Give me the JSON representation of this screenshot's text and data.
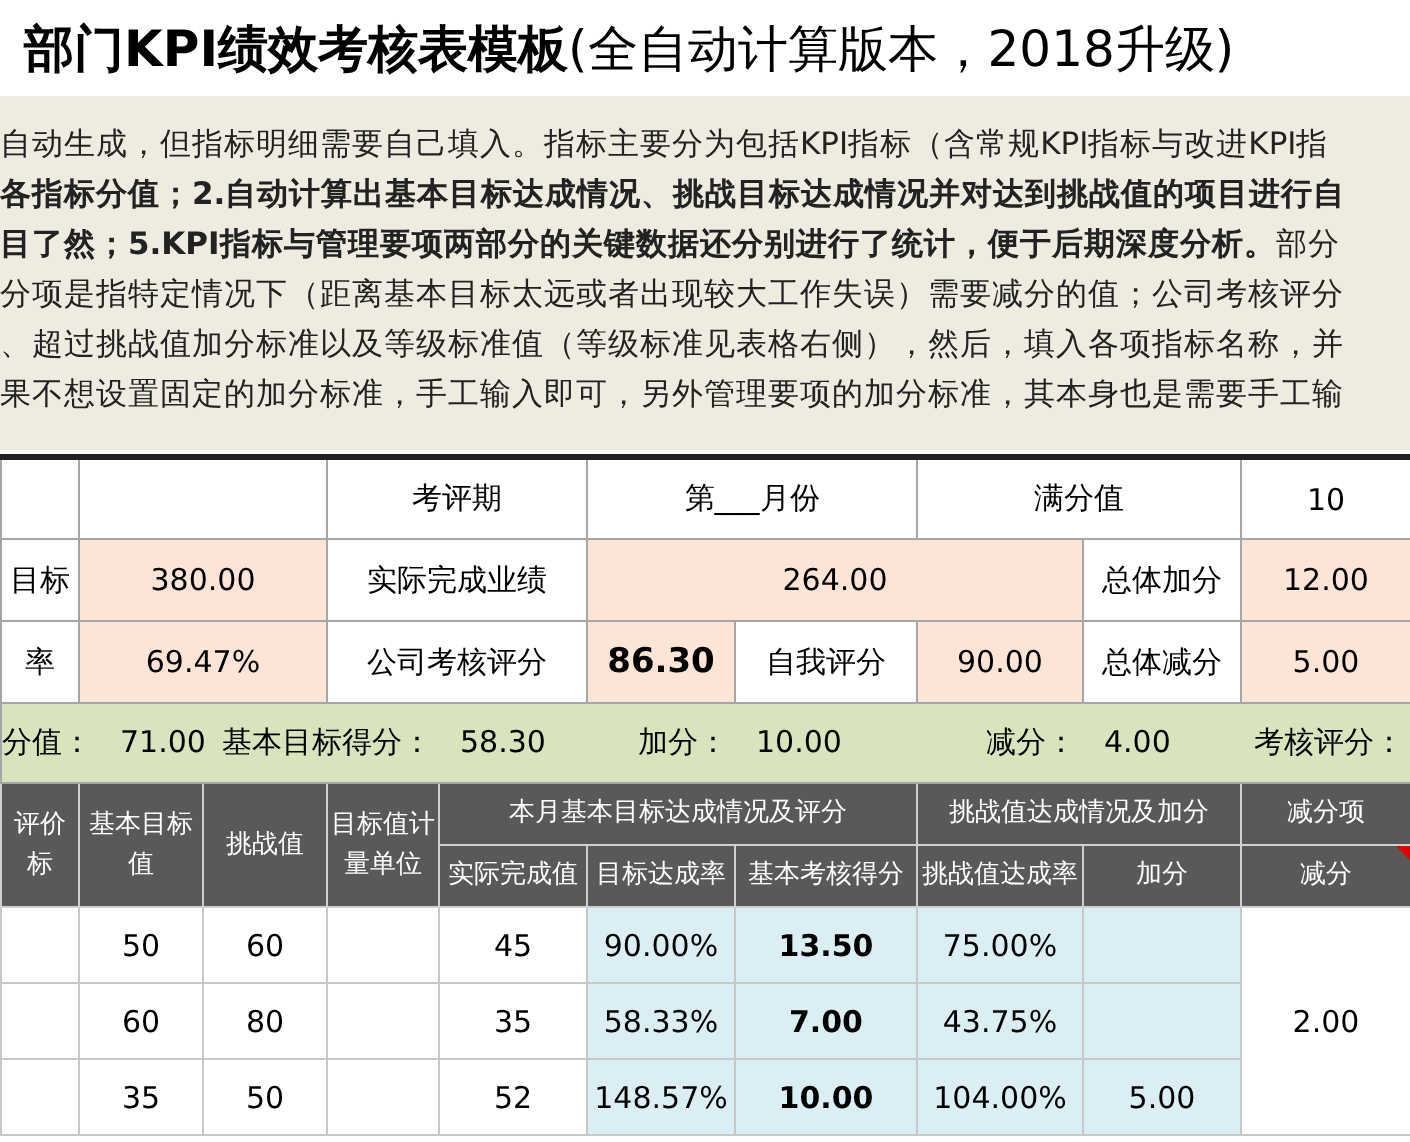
{
  "title": "**部门KPI绩效考核表模板**(全自动计算版本，2018升级)",
  "description_lines": [
    "自动生成，但指标明细需要自己填入。指标主要分为包括KPI指标（含常规KPI指标与改进KPI指",
    "**各指标分值；2.自动计算出基本目标达成情况、挑战目标达成情况并对达到挑战值的项目进行自**",
    "**目了然；5.KPI指标与管理要项两部分的关键数据还分别进行了统计，便于后期深度分析。**部分",
    "分项是指特定情况下（距离基本目标太远或者出现较大工作失误）需要减分的值；公司考核评分",
    "、超过挑战值加分标准以及等级标准值（等级标准见表格右侧），然后，填入各项指标名称，并",
    "果不想设置固定的加分标准，手工输入即可，另外管理要项的加分标准，其本身也是需要手工输"
  ],
  "summary_rows": [
    [
      {
        "text": "",
        "kind": "label"
      },
      {
        "text": "",
        "colspan": 2,
        "kind": "label"
      },
      {
        "text": "考评期",
        "colspan": 2,
        "kind": "label"
      },
      {
        "text": "第___月份",
        "colspan": 2,
        "kind": "label"
      },
      {
        "text": "满分值",
        "colspan": 2,
        "kind": "label"
      },
      {
        "text": "10",
        "kind": "label"
      }
    ],
    [
      {
        "text": "目标",
        "kind": "label"
      },
      {
        "text": "380.00",
        "colspan": 2,
        "kind": "value"
      },
      {
        "text": "实际完成业绩",
        "colspan": 2,
        "kind": "label"
      },
      {
        "text": "264.00",
        "colspan": 3,
        "kind": "value"
      },
      {
        "text": "总体加分",
        "kind": "label"
      },
      {
        "text": "12.00",
        "kind": "value"
      }
    ],
    [
      {
        "text": "率",
        "kind": "label"
      },
      {
        "text": "69.47%",
        "colspan": 2,
        "kind": "value"
      },
      {
        "text": "公司考核评分",
        "colspan": 2,
        "kind": "label"
      },
      {
        "text": "86.30",
        "kind": "value",
        "bold": true
      },
      {
        "text": "自我评分",
        "kind": "label"
      },
      {
        "text": "90.00",
        "kind": "value"
      },
      {
        "text": "总体减分",
        "kind": "label"
      },
      {
        "text": "5.00",
        "kind": "value"
      }
    ]
  ],
  "score_bar": [
    {
      "label": "分值：",
      "value": "71.00"
    },
    {
      "label": "基本目标得分：",
      "value": "58.30"
    },
    {
      "label": "加分：",
      "value": "10.00"
    },
    {
      "label": "减分：",
      "value": "4.00"
    },
    {
      "label": "考核评分："
    }
  ],
  "header_rows": [
    [
      {
        "text": "评价标",
        "rowspan": 2
      },
      {
        "text": "基本目标值",
        "rowspan": 2
      },
      {
        "text": "挑战值",
        "rowspan": 2
      },
      {
        "text": "目标值计量单位",
        "rowspan": 2
      },
      {
        "text": "本月基本目标达成情况及评分",
        "colspan": 3
      },
      {
        "text": "挑战值达成情况及加分",
        "colspan": 2
      },
      {
        "text": "减分项"
      }
    ],
    [
      {
        "text": "实际完成值"
      },
      {
        "text": "目标达成率"
      },
      {
        "text": "基本考核得分"
      },
      {
        "text": "挑战值达成率"
      },
      {
        "text": "加分"
      },
      {
        "text": "减分",
        "has_comment": true
      }
    ]
  ],
  "data_rows": [
    [
      {
        "text": "",
        "highlighted": false
      },
      {
        "text": "50",
        "highlighted": false
      },
      {
        "text": "60",
        "highlighted": false
      },
      {
        "text": "",
        "highlighted": false
      },
      {
        "text": "45",
        "highlighted": false
      },
      {
        "text": "90.00%",
        "highlighted": true
      },
      {
        "text": "13.50",
        "highlighted": true,
        "bold": true
      },
      {
        "text": "75.00%",
        "highlighted": true
      },
      {
        "text": "",
        "highlighted": true
      },
      {
        "text": "2.00",
        "highlighted": false,
        "rowspan": 3
      }
    ],
    [
      {
        "text": "",
        "highlighted": false
      },
      {
        "text": "60",
        "highlighted": false
      },
      {
        "text": "80",
        "highlighted": false
      },
      {
        "text": "",
        "highlighted": false
      },
      {
        "text": "35",
        "highlighted": false
      },
      {
        "text": "58.33%",
        "highlighted": true
      },
      {
        "text": "7.00",
        "highlighted": true,
        "bold": true
      },
      {
        "text": "43.75%",
        "highlighted": true
      },
      {
        "text": "",
        "highlighted": true
      }
    ],
    [
      {
        "text": "",
        "highlighted": false
      },
      {
        "text": "35",
        "highlighted": false
      },
      {
        "text": "50",
        "highlighted": false
      },
      {
        "text": "",
        "highlighted": false
      },
      {
        "text": "52",
        "highlighted": false
      },
      {
        "text": "148.57%",
        "highlighted": true
      },
      {
        "text": "10.00",
        "highlighted": true,
        "bold": true
      },
      {
        "text": "104.00%",
        "highlighted": true
      },
      {
        "text": "5.00",
        "highlighted": true
      }
    ]
  ]
}
